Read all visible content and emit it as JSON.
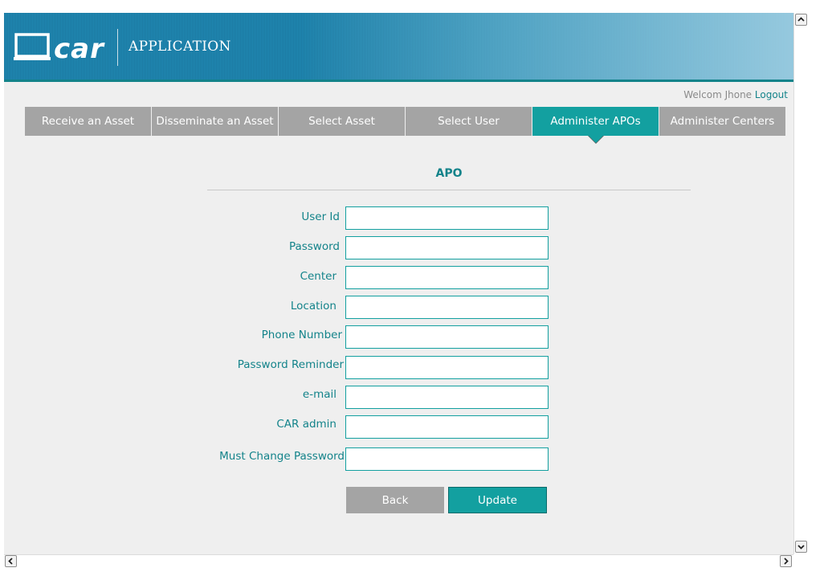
{
  "header": {
    "logo_text": "car",
    "app_title": "APPLICATION"
  },
  "welcome": {
    "greeting": "Welcom",
    "user": "Jhone",
    "logout": "Logout"
  },
  "nav": {
    "tabs": [
      {
        "label": "Receive an Asset",
        "active": false
      },
      {
        "label": "Disseminate an Asset",
        "active": false
      },
      {
        "label": "Select Asset",
        "active": false
      },
      {
        "label": "Select User",
        "active": false
      },
      {
        "label": "Administer APOs",
        "active": true
      },
      {
        "label": "Administer Centers",
        "active": false
      }
    ]
  },
  "form": {
    "title": "APO",
    "fields": [
      {
        "label": "User Id",
        "value": ""
      },
      {
        "label": "Password",
        "value": ""
      },
      {
        "label": "Center",
        "value": ""
      },
      {
        "label": "Location",
        "value": ""
      },
      {
        "label": "Phone Number",
        "value": ""
      },
      {
        "label": "Password Reminder",
        "value": ""
      },
      {
        "label": "e-mail",
        "value": ""
      },
      {
        "label": "CAR admin",
        "value": ""
      },
      {
        "label": "Must Change Password",
        "value": ""
      }
    ],
    "back_label": "Back",
    "update_label": "Update"
  },
  "colors": {
    "accent": "#13a0a0",
    "text_teal": "#13838a",
    "tab_gray": "#a4a4a4",
    "header_blue": "#1c7ca0"
  },
  "icons": {
    "scroll_up": "chevron-up-icon",
    "scroll_down": "chevron-down-icon",
    "scroll_left": "chevron-left-icon",
    "scroll_right": "chevron-right-icon",
    "logo": "laptop-logo-icon"
  }
}
